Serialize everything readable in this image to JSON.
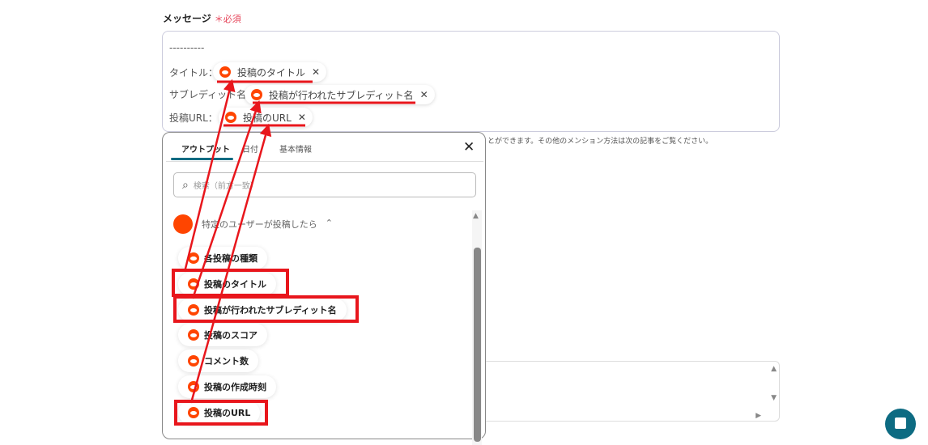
{
  "field": {
    "label": "メッセージ",
    "required_mark": "＊",
    "required_text": "必須"
  },
  "message": {
    "dashes": "----------",
    "rows": [
      {
        "label": "タイトル：",
        "chip": "投稿のタイトル"
      },
      {
        "label": "サブレディット名：",
        "chip": "投稿が行われたサブレディット名"
      },
      {
        "label": "投稿URL：",
        "chip": "投稿のURL"
      }
    ]
  },
  "help_text": "とができます。その他のメンション方法は次の記事をご覧ください。",
  "popup": {
    "tabs": [
      "アウトプット",
      "日付",
      "基本情報"
    ],
    "active_tab": "アウトプット",
    "search_placeholder": "検索（前方一致）",
    "group": "特定のユーザーが投稿したら",
    "items": [
      "各投稿の種類",
      "投稿のタイトル",
      "投稿が行われたサブレディット名",
      "投稿のスコア",
      "コメント数",
      "投稿の作成時刻",
      "投稿のURL"
    ]
  },
  "colors": {
    "accent": "#0d6b82",
    "annotation": "#e8161c",
    "reddit": "#ff4500",
    "required": "#e6455a"
  },
  "icons": [
    "reddit-icon",
    "close-icon",
    "search-icon",
    "chevron-up-icon",
    "chat-icon"
  ]
}
